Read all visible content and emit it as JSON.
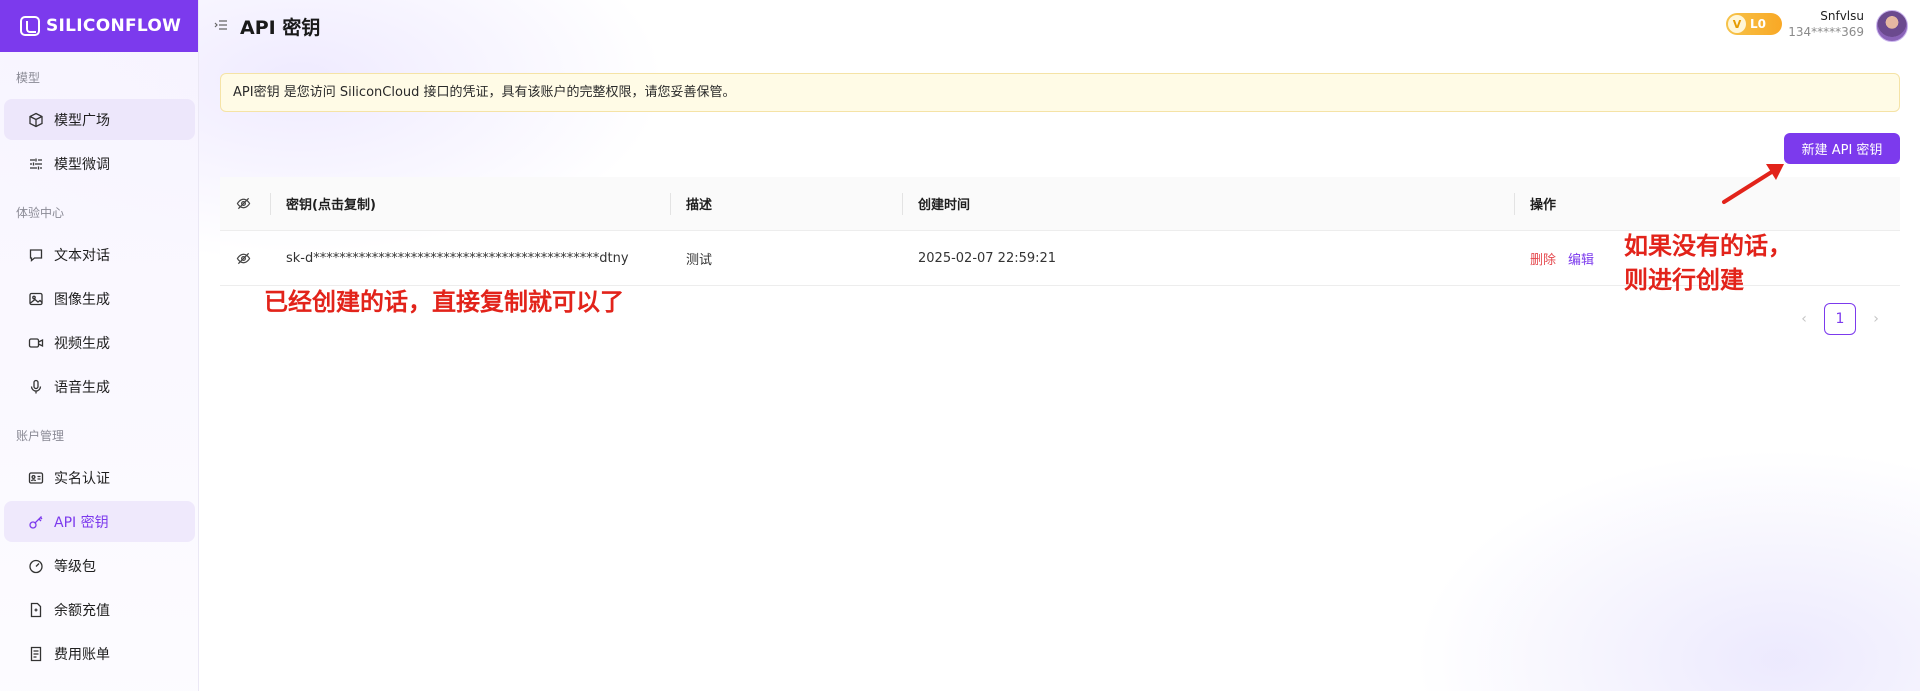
{
  "app": {
    "logo_text": "SILICONFLOW"
  },
  "sidebar": {
    "sections": [
      {
        "title": "模型"
      },
      {
        "title": "体验中心"
      },
      {
        "title": "账户管理"
      }
    ],
    "items": [
      {
        "label": "模型广场",
        "icon": "cube-icon"
      },
      {
        "label": "模型微调",
        "icon": "sliders-icon"
      },
      {
        "label": "文本对话",
        "icon": "chat-icon"
      },
      {
        "label": "图像生成",
        "icon": "image-icon"
      },
      {
        "label": "视频生成",
        "icon": "video-icon"
      },
      {
        "label": "语音生成",
        "icon": "microphone-icon"
      },
      {
        "label": "实名认证",
        "icon": "id-card-icon"
      },
      {
        "label": "API 密钥",
        "icon": "key-icon"
      },
      {
        "label": "等级包",
        "icon": "gauge-icon"
      },
      {
        "label": "余额充值",
        "icon": "wallet-icon"
      },
      {
        "label": "费用账单",
        "icon": "bill-icon"
      }
    ]
  },
  "header": {
    "title": "API 密钥",
    "level_badge_v": "V",
    "level_badge_text": "L0",
    "user_name": "Snfvlsu",
    "user_phone": "134*****369"
  },
  "notice": {
    "text": "API密钥 是您访问 SiliconCloud 接口的凭证，具有该账户的完整权限，请您妥善保管。"
  },
  "actions": {
    "new_key_label": "新建 API 密钥"
  },
  "table": {
    "columns": [
      "密钥(点击复制)",
      "描述",
      "创建时间",
      "操作"
    ],
    "rows": [
      {
        "key": "sk-d********************************************dtny",
        "description": "测试",
        "created_at": "2025-02-07 22:59:21",
        "delete_label": "删除",
        "edit_label": "编辑"
      }
    ]
  },
  "pagination": {
    "current_page": "1",
    "prev": "‹",
    "next": "›"
  },
  "annotations": {
    "left_note": "已经创建的话，直接复制就可以了",
    "right_note_line1": "如果没有的话，",
    "right_note_line2": "则进行创建"
  },
  "colors": {
    "brand": "#7c3aed",
    "danger": "#e5484d",
    "annotation": "#e2231a",
    "notice_bg": "#fffbe6"
  }
}
